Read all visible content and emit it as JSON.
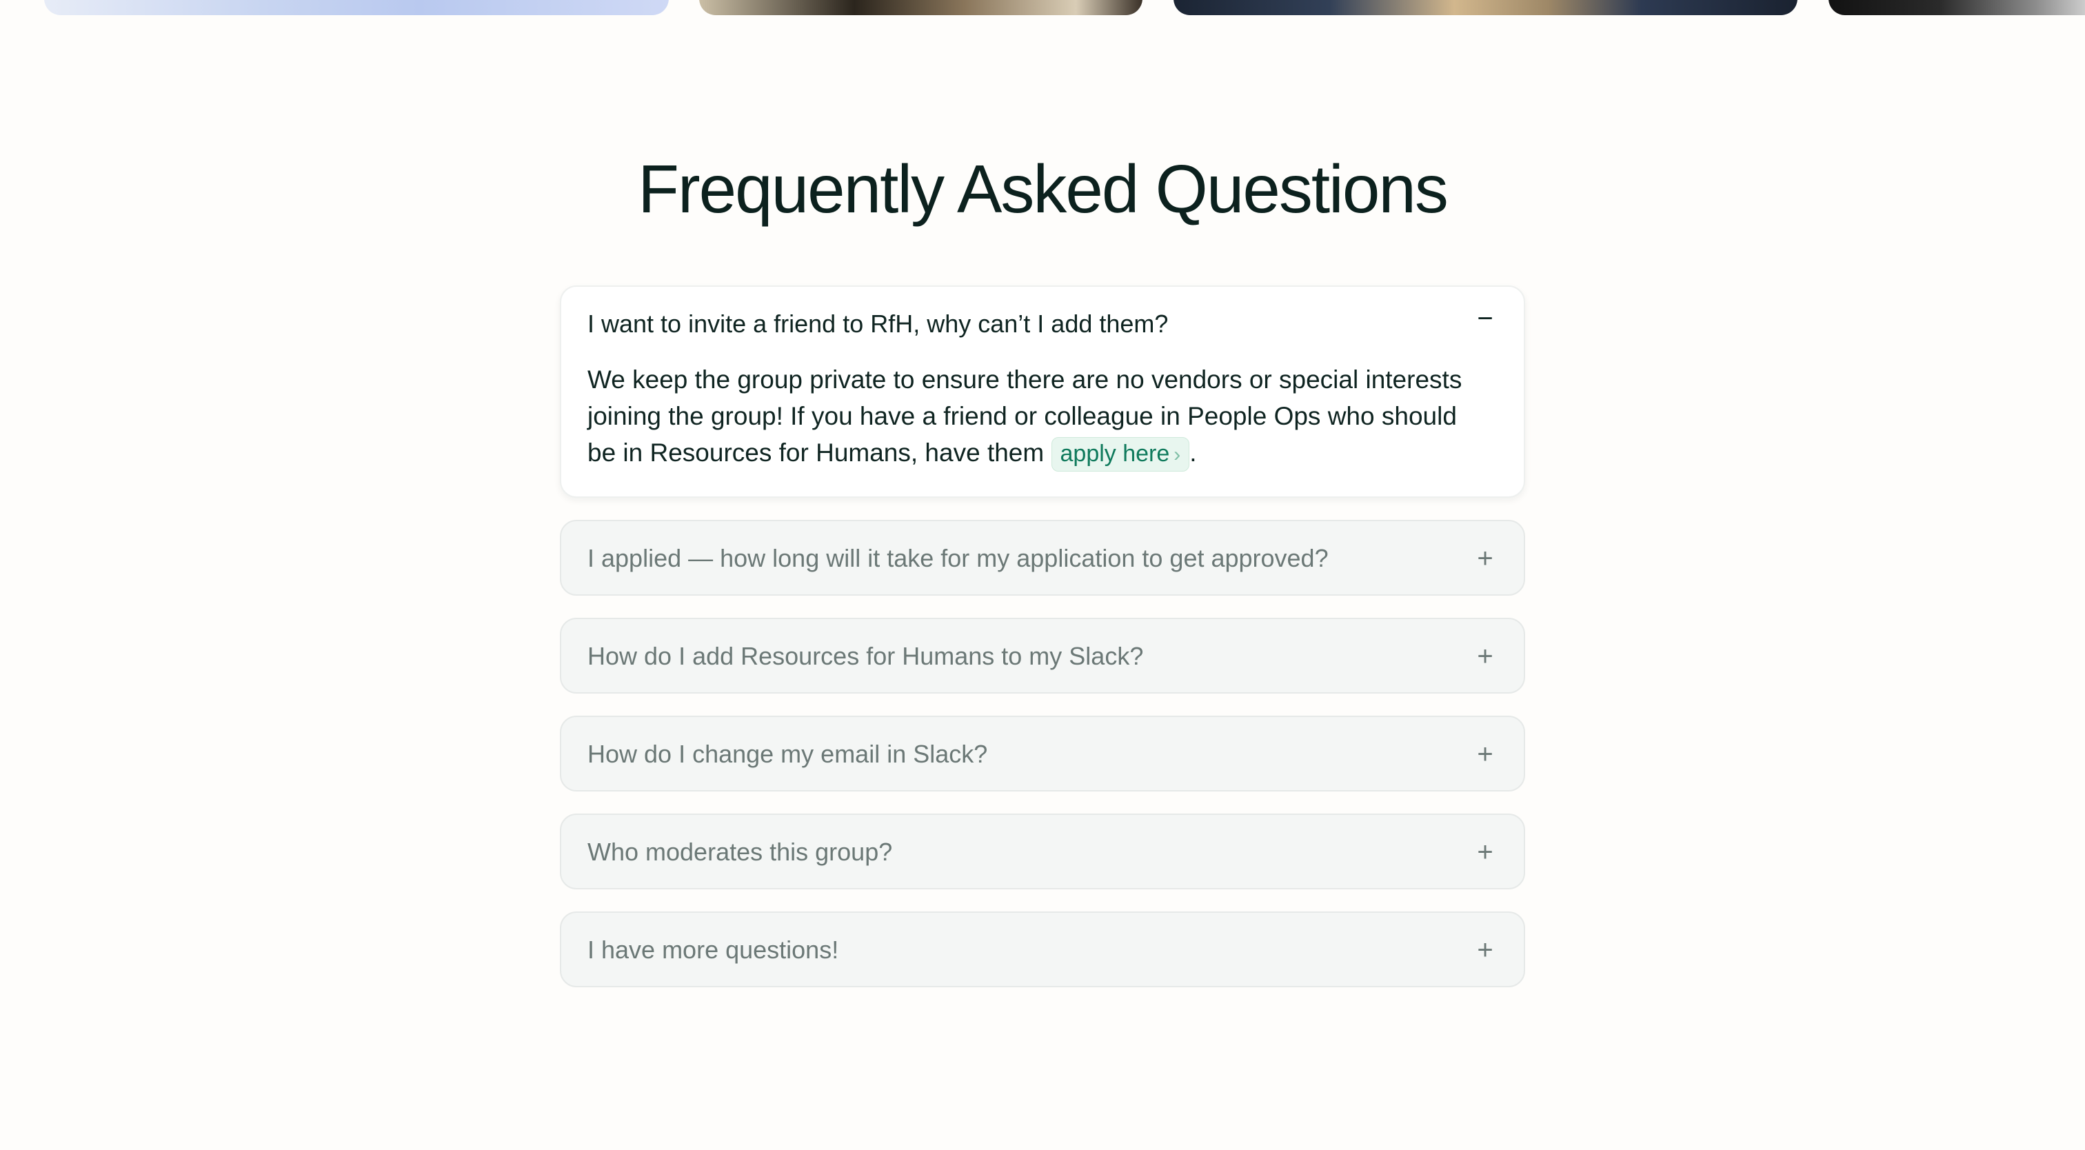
{
  "faq": {
    "title": "Frequently Asked Questions",
    "items": [
      {
        "question": "I want to invite a friend to RfH, why can’t I add them?",
        "expanded": true,
        "toggle_icon": "−",
        "answer_before": "We keep the group private to ensure there are no vendors or special interests joining the group! If you have a friend or colleague in People Ops who should be in Resources for Humans, have them ",
        "link_label": "apply here",
        "link_chevron": "›",
        "answer_after": "."
      },
      {
        "question": "I applied — how long will it take for my application to get approved?",
        "expanded": false,
        "toggle_icon": "+"
      },
      {
        "question": "How do I add Resources for Humans to my Slack?",
        "expanded": false,
        "toggle_icon": "+"
      },
      {
        "question": "How do I change my email in Slack?",
        "expanded": false,
        "toggle_icon": "+"
      },
      {
        "question": "Who moderates this group?",
        "expanded": false,
        "toggle_icon": "+"
      },
      {
        "question": "I have more questions!",
        "expanded": false,
        "toggle_icon": "+"
      }
    ]
  },
  "colors": {
    "background": "#fefdfb",
    "heading": "#0c211e",
    "muted_text": "#6b7876",
    "link_bg": "#e8f6ef",
    "link_text": "#0f7a5c"
  }
}
